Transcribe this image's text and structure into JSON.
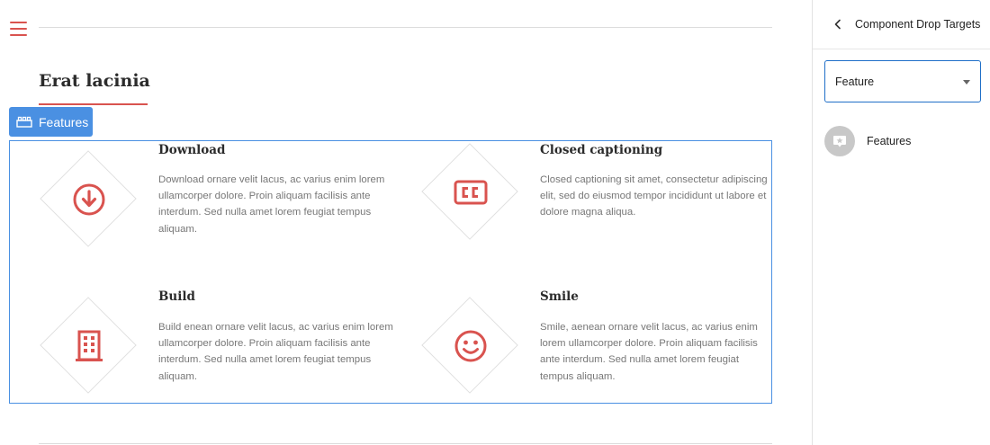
{
  "page": {
    "title": "Erat lacinia"
  },
  "component_tag": {
    "label": "Features",
    "icon": "blocks-icon"
  },
  "features": [
    {
      "title": "Download",
      "icon": "download-icon",
      "description": "Download ornare velit lacus, ac varius enim lorem ullamcorper dolore. Proin aliquam facilisis ante interdum. Sed nulla amet lorem feugiat tempus aliquam."
    },
    {
      "title": "Closed captioning",
      "icon": "closed-captioning-icon",
      "description": "Closed captioning sit amet, consectetur adipiscing elit, sed do eiusmod tempor incididunt ut labore et dolore magna aliqua."
    },
    {
      "title": "Build",
      "icon": "building-icon",
      "description": "Build enean ornare velit lacus, ac varius enim lorem ullamcorper dolore. Proin aliquam facilisis ante interdum. Sed nulla amet lorem feugiat tempus aliquam."
    },
    {
      "title": "Smile",
      "icon": "smile-icon",
      "description": "Smile, aenean ornare velit lacus, ac varius enim lorem ullamcorper dolore. Proin aliquam facilisis ante interdum. Sed nulla amet lorem feugiat tempus aliquam."
    }
  ],
  "panel": {
    "title": "Component Drop Targets",
    "select_value": "Feature",
    "items": [
      {
        "label": "Features",
        "icon": "feature-component-icon"
      }
    ]
  },
  "colors": {
    "accent": "#d9534f",
    "selection": "#4a90e2",
    "select_border": "#1f6fc8"
  }
}
